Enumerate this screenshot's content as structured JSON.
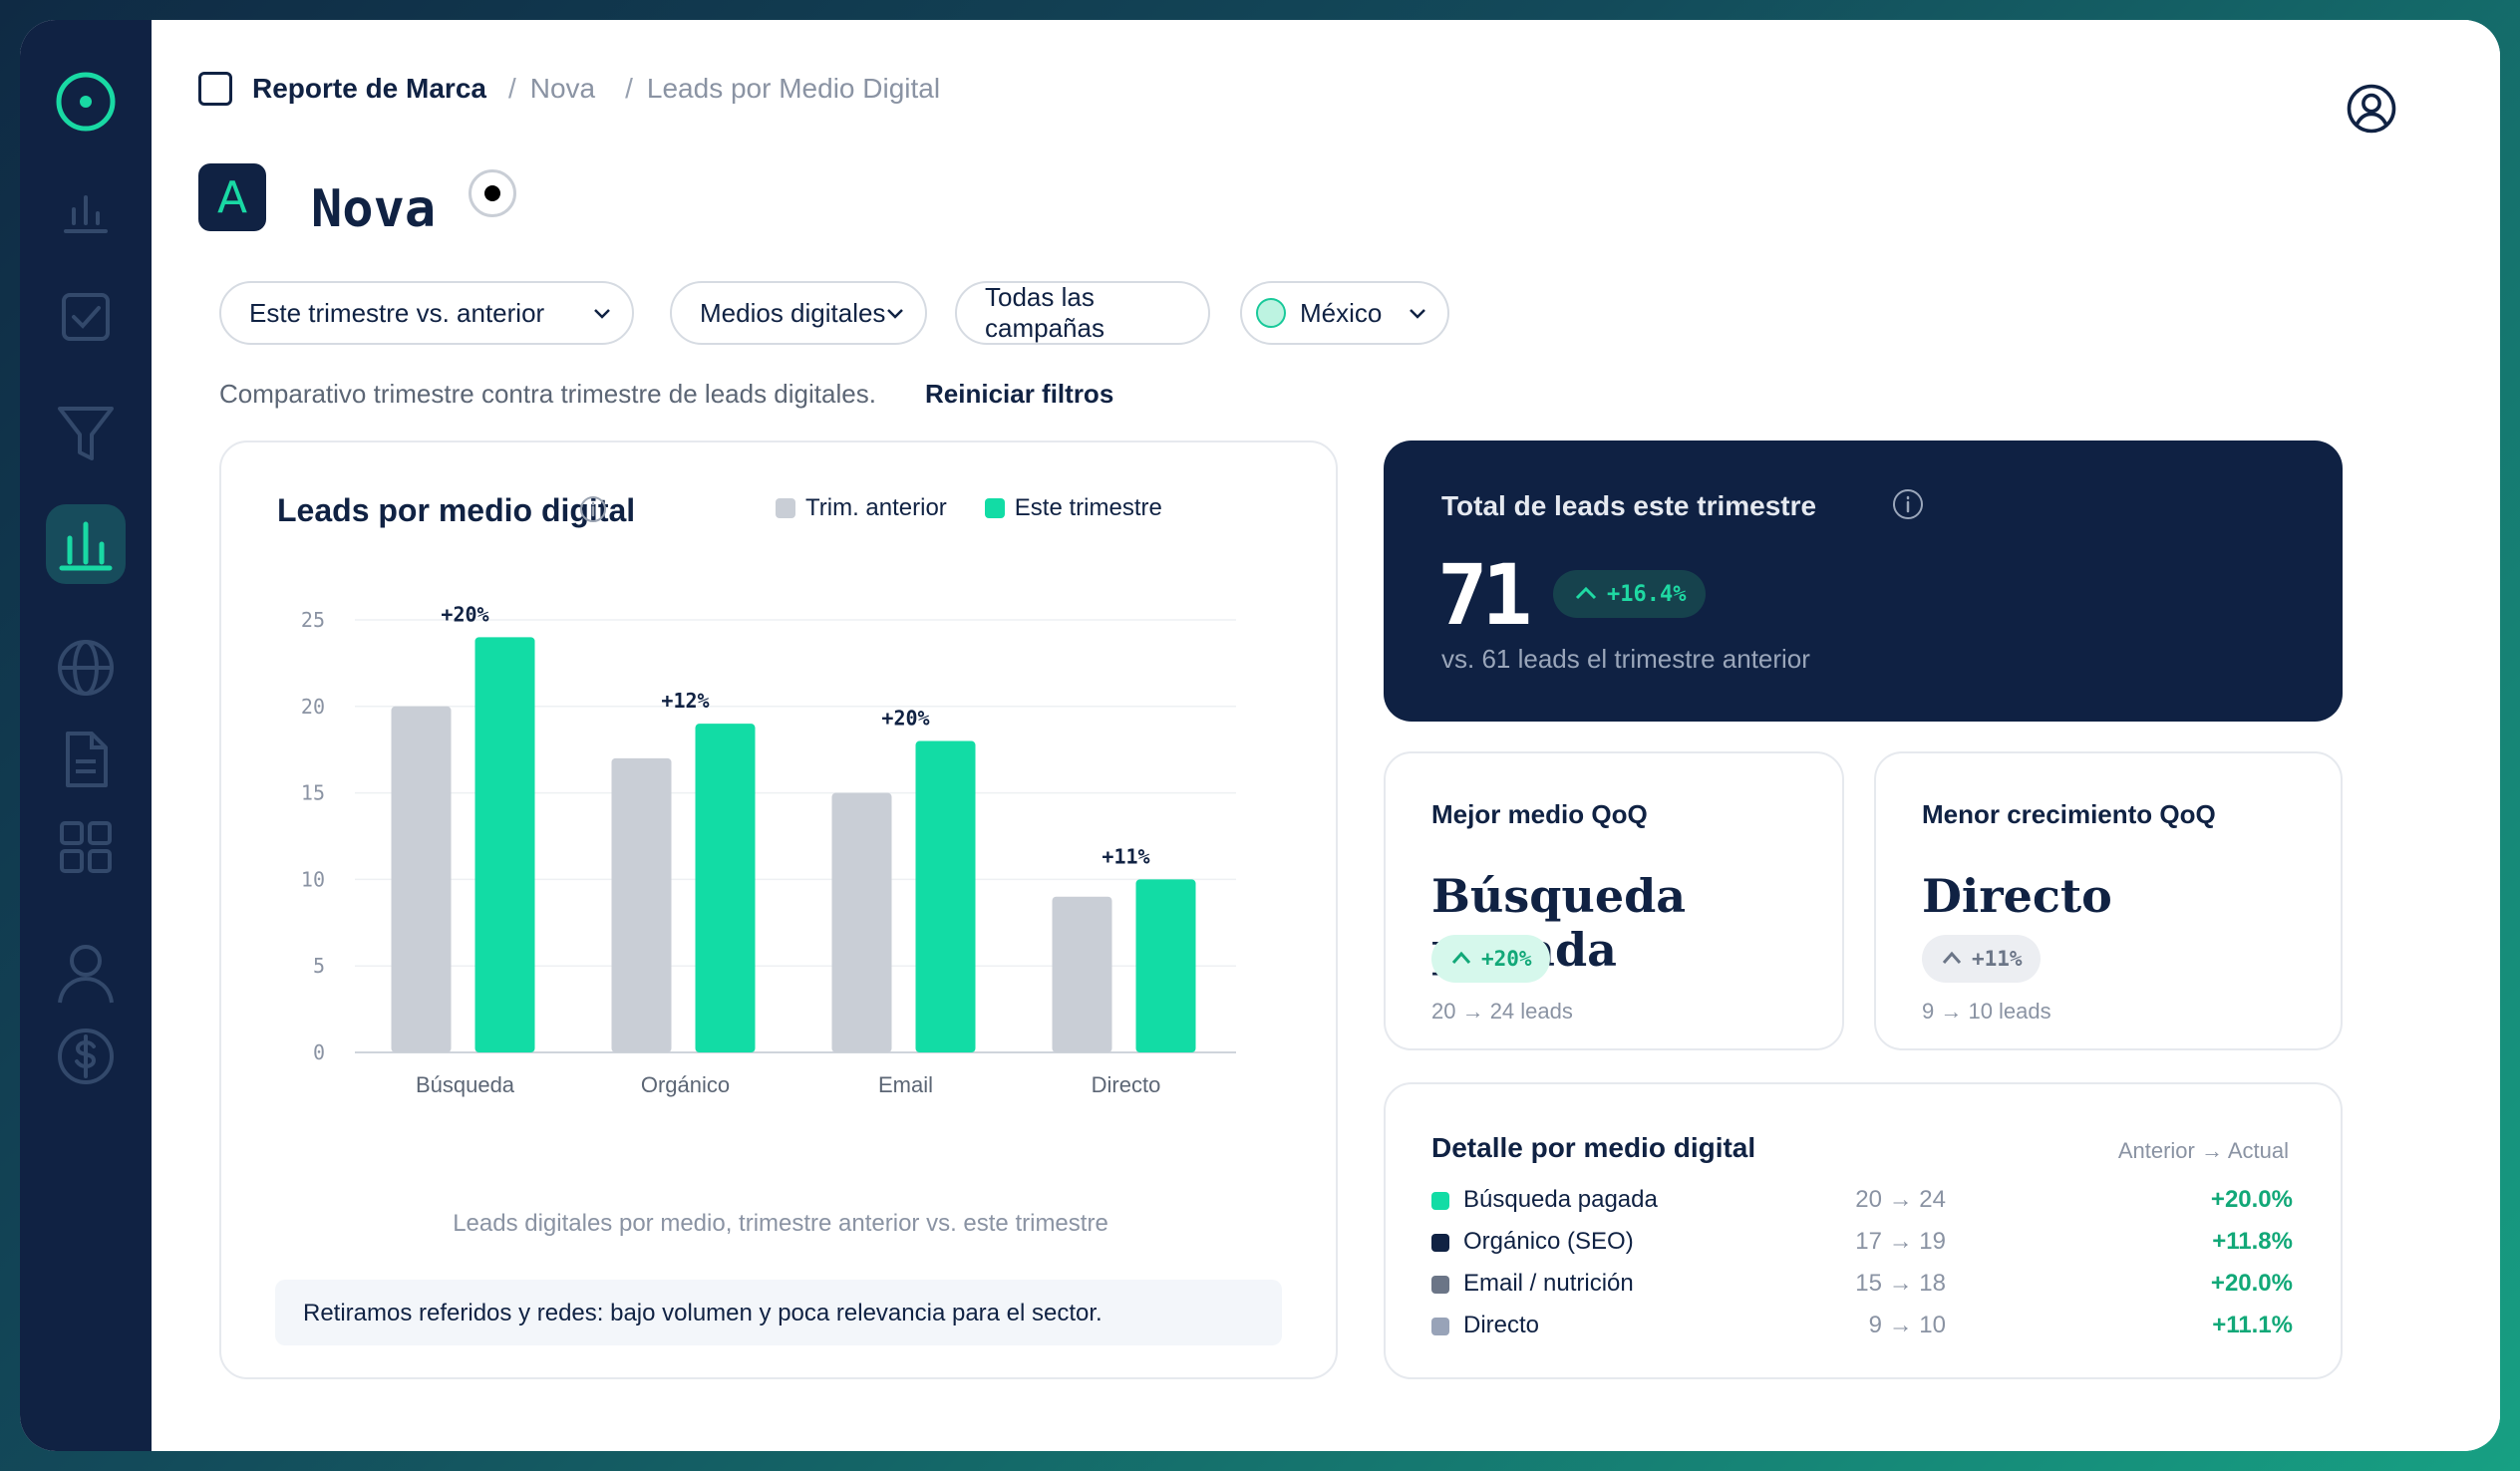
{
  "breadcrumb": {
    "root": "Reporte de Marca",
    "brand": "Nova",
    "section": "Leads por Medio Digital"
  },
  "page": {
    "logo_letter": "A",
    "title": "Nova"
  },
  "filters": {
    "period": "Este trimestre vs. anterior",
    "channels": "Medios digitales",
    "campaigns": "Todas las campañas",
    "region": "México"
  },
  "subline": {
    "description": "Comparativo trimestre contra trimestre de leads digitales.",
    "reset_label": "Reiniciar filtros"
  },
  "chart_card": {
    "title": "Leads por medio digital",
    "caption": "Leads digitales por medio, trimestre anterior vs. este trimestre",
    "note": "Retiramos referidos y redes: bajo volumen y poca relevancia para el sector."
  },
  "chart_data": {
    "type": "bar",
    "title": "Leads por medio digital",
    "categories": [
      "Búsqueda",
      "Orgánico",
      "Email",
      "Directo"
    ],
    "series": [
      {
        "name": "Trim. anterior",
        "values": [
          20,
          17,
          15,
          9
        ],
        "color": "#c9ced6"
      },
      {
        "name": "Este trimestre",
        "values": [
          24,
          19,
          18,
          10
        ],
        "color": "#12dca5"
      }
    ],
    "bar_labels": [
      "+20%",
      "+12%",
      "+20%",
      "+11%"
    ],
    "yticks": [
      0,
      5,
      10,
      15,
      20,
      25
    ],
    "ylim": [
      0,
      25
    ],
    "grid": true,
    "legend": "top-right"
  },
  "total": {
    "label": "Total de leads este trimestre",
    "value": "71",
    "change": "+16.4%",
    "sub": "vs. 61 leads el trimestre anterior"
  },
  "best": {
    "label": "Mejor medio QoQ",
    "value": "Búsqueda pagada",
    "change": "+20%",
    "sub": "20 → 24 leads"
  },
  "worst": {
    "label": "Menor crecimiento QoQ",
    "value": "Directo",
    "change": "+11%",
    "sub": "9 → 10 leads"
  },
  "detail": {
    "title": "Detalle por medio digital",
    "header": "Anterior → Actual",
    "rows": [
      {
        "name": "Búsqueda pagada",
        "values": "20 → 24",
        "pct": "+20.0%",
        "color": "#12dca5"
      },
      {
        "name": "Orgánico (SEO)",
        "values": "17 → 19",
        "pct": "+11.8%",
        "color": "#102243"
      },
      {
        "name": "Email / nutrición",
        "values": "15 → 18",
        "pct": "+20.0%",
        "color": "#6b7587"
      },
      {
        "name": "Directo",
        "values": "9 → 10",
        "pct": "+11.1%",
        "color": "#98a3b8"
      }
    ]
  },
  "colors": {
    "navy": "#102243",
    "accent": "#12dca5",
    "muted_bar": "#c9ced6",
    "positive": "#12a878"
  }
}
